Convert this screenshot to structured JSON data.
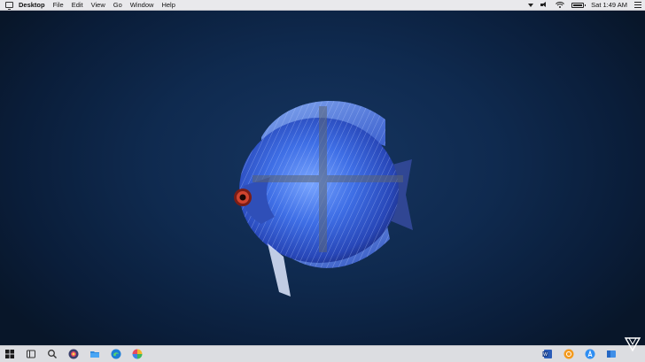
{
  "menubar": {
    "app_name": "Desktop",
    "menus": [
      "File",
      "Edit",
      "View",
      "Go",
      "Window",
      "Help"
    ],
    "clock": "Sat 1:49 AM",
    "status_icons": [
      "dropdown-arrow-icon",
      "volume-icon",
      "wifi-icon",
      "battery-icon",
      "menu-list-icon"
    ]
  },
  "desktop": {
    "wallpaper": "discus-fish-with-windows-logo",
    "background_color": "#0f2a4f"
  },
  "taskbar": {
    "left_icons": [
      "start-icon",
      "task-view-icon",
      "search-icon",
      "browser-icon",
      "file-explorer-icon",
      "edge-icon",
      "photos-icon"
    ],
    "right_icons": [
      "word-icon",
      "app-orange-icon",
      "app-store-icon",
      "file-manager-icon",
      "notification-icon"
    ]
  },
  "colors": {
    "menubar_bg": "#e9e9ec",
    "taskbar_bg": "#dcdde1",
    "fish_blue": "#3a6ee8"
  }
}
